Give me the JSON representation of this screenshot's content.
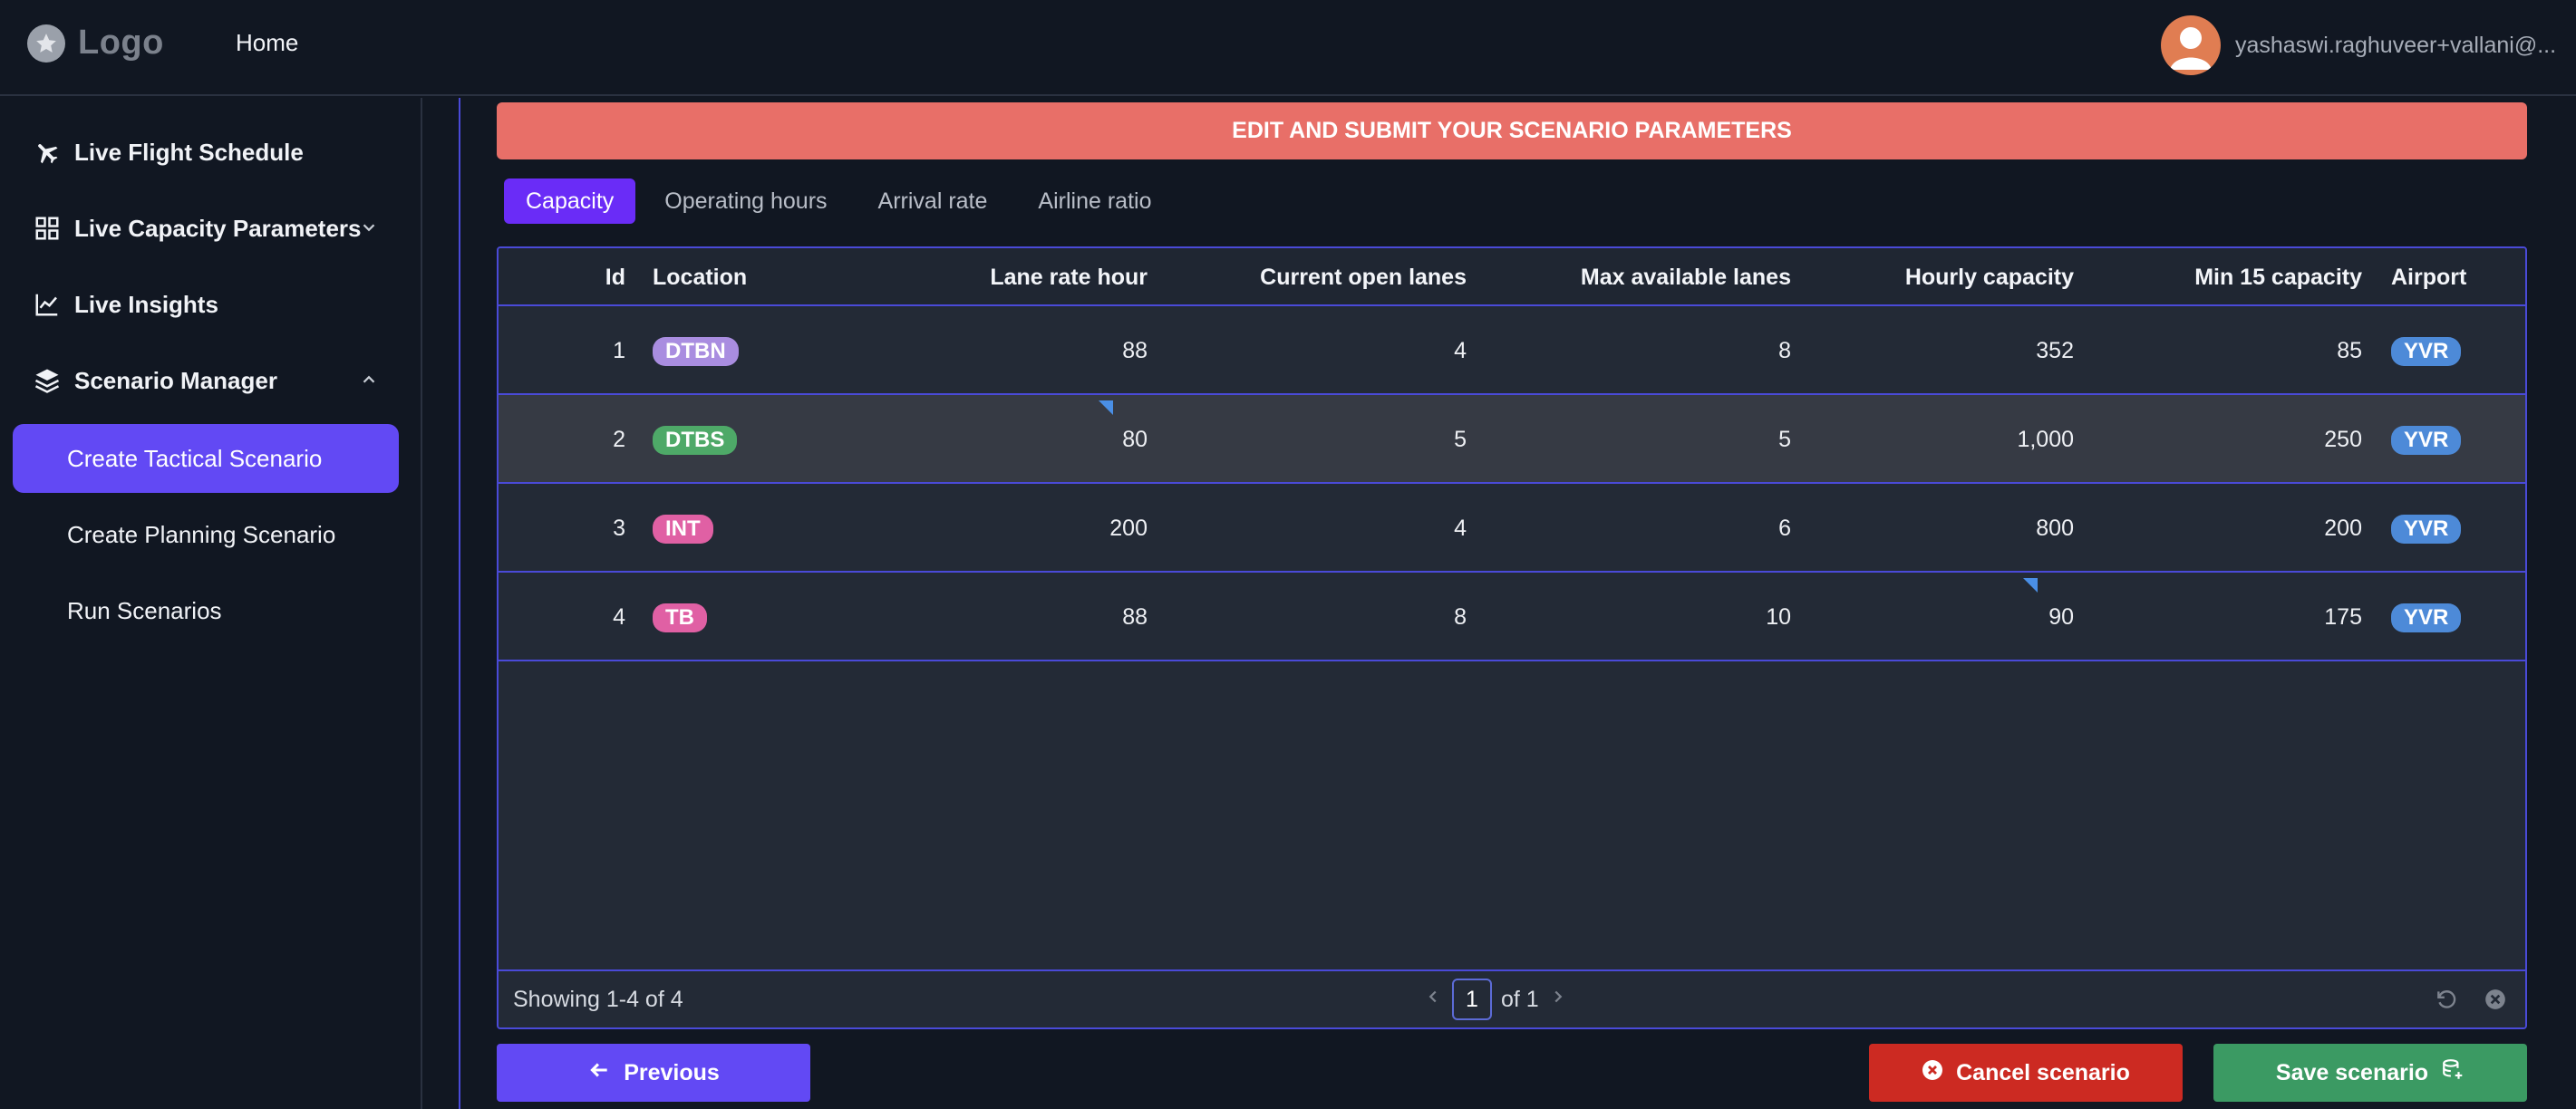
{
  "header": {
    "logo_text": "Logo",
    "home_label": "Home",
    "user_name": "yashaswi.raghuveer+vallani@..."
  },
  "sidebar": {
    "items": [
      {
        "label": "Live Flight Schedule",
        "icon": "airplane-icon"
      },
      {
        "label": "Live Capacity Parameters",
        "icon": "grid-icon",
        "expanded": false
      },
      {
        "label": "Live Insights",
        "icon": "chart-line-icon"
      },
      {
        "label": "Scenario Manager",
        "icon": "layers-icon",
        "expanded": true
      }
    ],
    "subitems": [
      {
        "label": "Create Tactical Scenario",
        "active": true
      },
      {
        "label": "Create Planning Scenario",
        "active": false
      },
      {
        "label": "Run Scenarios",
        "active": false
      }
    ]
  },
  "main": {
    "banner": "EDIT AND SUBMIT YOUR SCENARIO PARAMETERS",
    "tabs": [
      "Capacity",
      "Operating hours",
      "Arrival rate",
      "Airline ratio"
    ],
    "active_tab": "Capacity",
    "columns": [
      "Id",
      "Location",
      "Lane rate hour",
      "Current open lanes",
      "Max available lanes",
      "Hourly capacity",
      "Min 15 capacity",
      "Airport"
    ],
    "rows": [
      {
        "id": "1",
        "location": "DTBN",
        "location_color": "#a98de0",
        "lane_rate_hour": "88",
        "current_open_lanes": "4",
        "max_available_lanes": "8",
        "hourly_capacity": "352",
        "min15_capacity": "85",
        "airport": "YVR"
      },
      {
        "id": "2",
        "location": "DTBS",
        "location_color": "#4ea968",
        "lane_rate_hour": "80",
        "current_open_lanes": "5",
        "max_available_lanes": "5",
        "hourly_capacity": "1,000",
        "min15_capacity": "250",
        "airport": "YVR"
      },
      {
        "id": "3",
        "location": "INT",
        "location_color": "#e060a4",
        "lane_rate_hour": "200",
        "current_open_lanes": "4",
        "max_available_lanes": "6",
        "hourly_capacity": "800",
        "min15_capacity": "200",
        "airport": "YVR"
      },
      {
        "id": "4",
        "location": "TB",
        "location_color": "#e060a4",
        "lane_rate_hour": "88",
        "current_open_lanes": "8",
        "max_available_lanes": "10",
        "hourly_capacity": "90",
        "min15_capacity": "175",
        "airport": "YVR"
      }
    ],
    "airport_color": "#4d8ad8",
    "footer": {
      "showing": "Showing 1-4 of 4",
      "page": "1",
      "of_label": "of 1"
    },
    "buttons": {
      "previous": "Previous",
      "cancel": "Cancel scenario",
      "save": "Save scenario"
    }
  },
  "colors": {
    "accent": "#6249f4",
    "banner": "#e86f68",
    "cancel": "#cc2a22",
    "save": "#3b9a63",
    "grid_border": "#4a4ad8"
  }
}
